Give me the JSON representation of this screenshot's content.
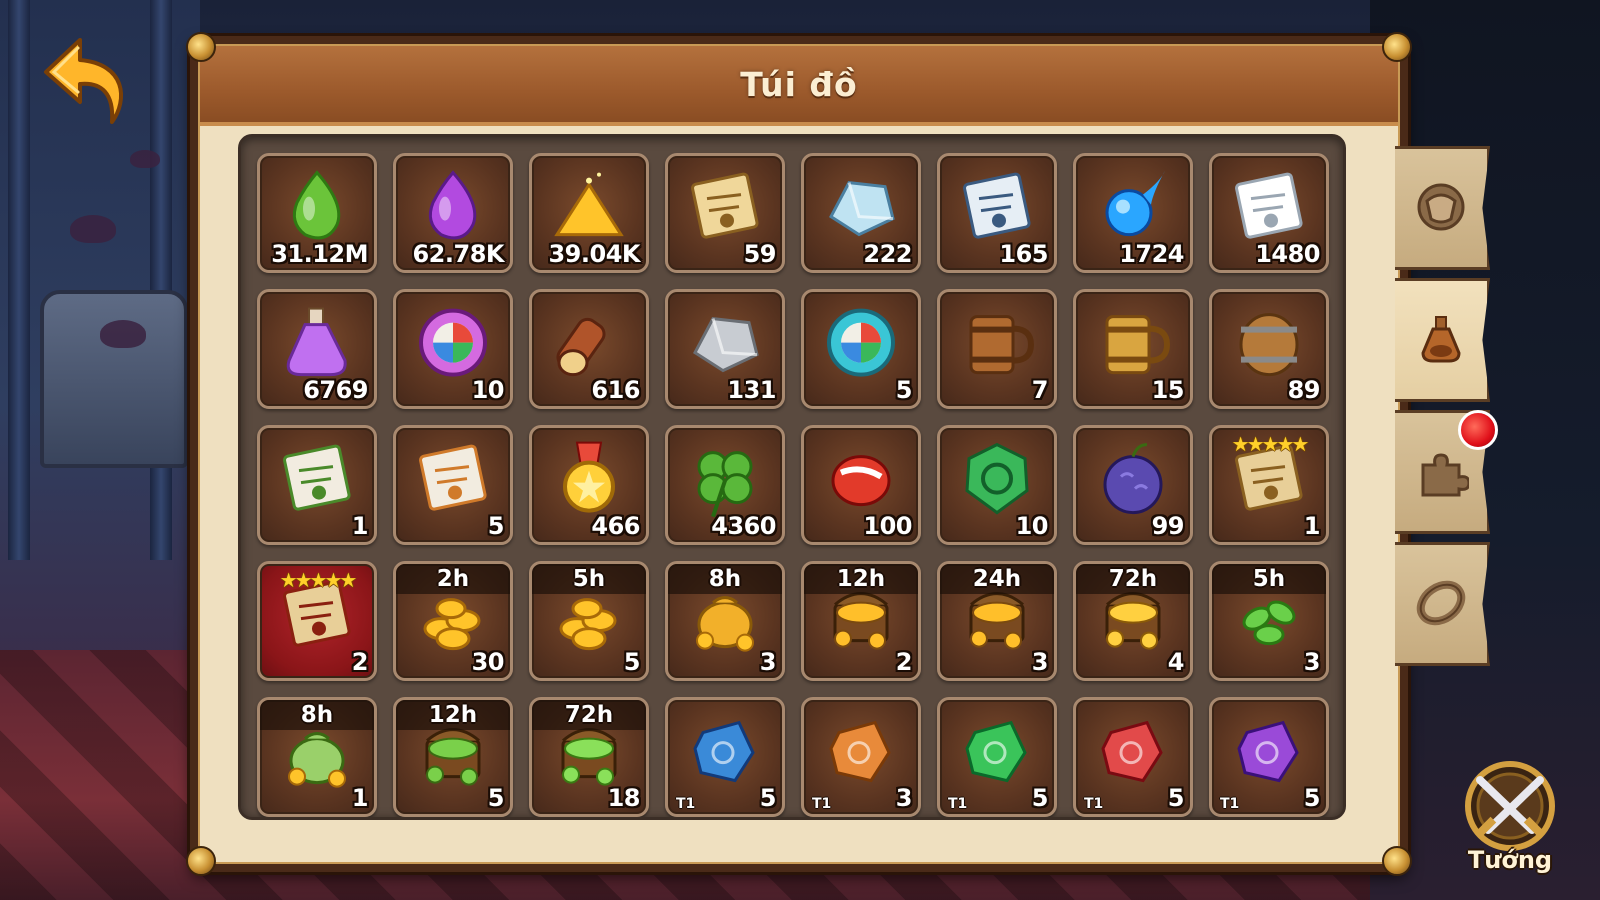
{
  "window": {
    "title": "Túi đồ"
  },
  "hero_button": {
    "label": "Tướng"
  },
  "side_tabs": [
    {
      "name": "equipment-tab",
      "icon": "armor-icon",
      "active": false
    },
    {
      "name": "items-tab",
      "icon": "potion-icon",
      "active": true
    },
    {
      "name": "fragments-tab",
      "icon": "puzzle-icon",
      "active": false,
      "notification": true
    },
    {
      "name": "rings-tab",
      "icon": "ring-icon",
      "active": false
    }
  ],
  "colors": {
    "panel": "#4a2a18",
    "title_bar": "#9c5a2c",
    "slot": "#5a3420",
    "notif": "#e0101a"
  },
  "inventory": [
    {
      "icon": "green-drop-icon",
      "qty": "31.12M"
    },
    {
      "icon": "purple-flame-icon",
      "qty": "62.78K"
    },
    {
      "icon": "gold-pile-icon",
      "qty": "39.04K"
    },
    {
      "icon": "battle-scroll-icon",
      "qty": "59"
    },
    {
      "icon": "ice-crystal-icon",
      "qty": "222"
    },
    {
      "icon": "map-scroll-icon",
      "qty": "165"
    },
    {
      "icon": "blue-fireball-icon",
      "qty": "1724"
    },
    {
      "icon": "white-paper-icon",
      "qty": "1480"
    },
    {
      "icon": "purple-potion-icon",
      "qty": "6769"
    },
    {
      "icon": "purple-compass-icon",
      "qty": "10"
    },
    {
      "icon": "wood-log-icon",
      "qty": "616"
    },
    {
      "icon": "iron-ingot-icon",
      "qty": "131"
    },
    {
      "icon": "teal-compass-icon",
      "qty": "5"
    },
    {
      "icon": "wooden-mug-icon",
      "qty": "7"
    },
    {
      "icon": "golden-mug-icon",
      "qty": "15"
    },
    {
      "icon": "barrel-icon",
      "qty": "89"
    },
    {
      "icon": "green-letter-icon",
      "qty": "1"
    },
    {
      "icon": "orange-letter-icon",
      "qty": "5"
    },
    {
      "icon": "star-medal-icon",
      "qty": "466"
    },
    {
      "icon": "clover-icon",
      "qty": "4360"
    },
    {
      "icon": "red-gem-icon",
      "qty": "100"
    },
    {
      "icon": "green-emblem-icon",
      "qty": "10"
    },
    {
      "icon": "devil-fruit-icon",
      "qty": "99"
    },
    {
      "icon": "hero-scroll-icon",
      "qty": "1",
      "stars": "★★★★★"
    },
    {
      "icon": "hero-scroll-red-icon",
      "qty": "2",
      "stars": "★★★★★",
      "red": true
    },
    {
      "icon": "gold-coins-icon",
      "qty": "30",
      "time": "2h"
    },
    {
      "icon": "gold-coins-icon",
      "qty": "5",
      "time": "5h"
    },
    {
      "icon": "gold-bag-icon",
      "qty": "3",
      "time": "8h"
    },
    {
      "icon": "gold-chest-icon",
      "qty": "2",
      "time": "12h"
    },
    {
      "icon": "gold-chest-icon",
      "qty": "3",
      "time": "24h"
    },
    {
      "icon": "gold-treasure-icon",
      "qty": "4",
      "time": "72h"
    },
    {
      "icon": "green-leaves-icon",
      "qty": "3",
      "time": "5h"
    },
    {
      "icon": "green-bag-icon",
      "qty": "1",
      "time": "8h"
    },
    {
      "icon": "green-chest-icon",
      "qty": "5",
      "time": "12h"
    },
    {
      "icon": "green-treasure-icon",
      "qty": "18",
      "time": "72h"
    },
    {
      "icon": "blue-rune-icon",
      "qty": "5",
      "tier": "T1"
    },
    {
      "icon": "orange-rune-icon",
      "qty": "3",
      "tier": "T1"
    },
    {
      "icon": "green-rune-icon",
      "qty": "5",
      "tier": "T1"
    },
    {
      "icon": "red-rune-icon",
      "qty": "5",
      "tier": "T1"
    },
    {
      "icon": "purple-rune-icon",
      "qty": "5",
      "tier": "T1"
    }
  ]
}
